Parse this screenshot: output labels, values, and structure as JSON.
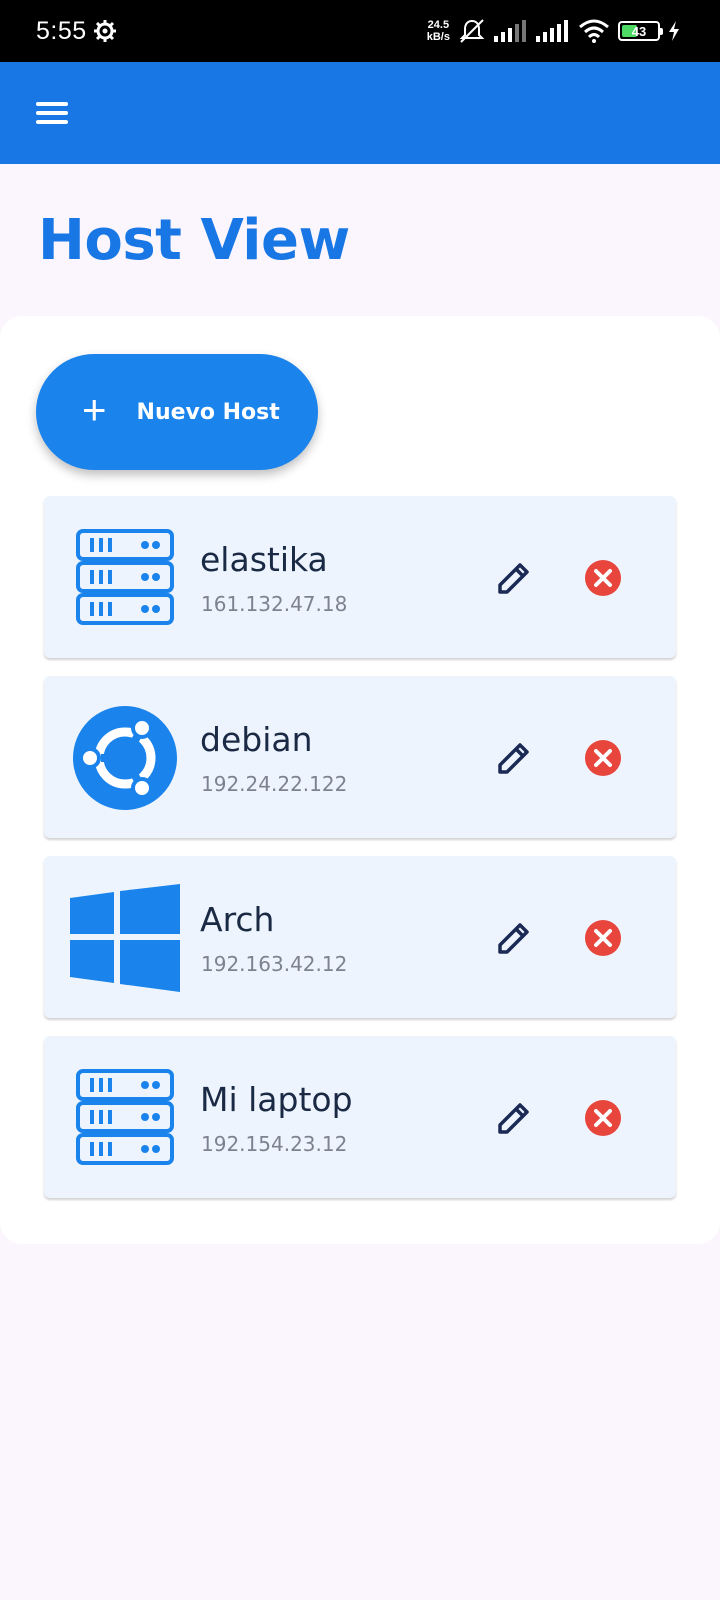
{
  "status_bar": {
    "time": "5:55",
    "net_speed_value": "24.5",
    "net_speed_unit": "kB/s",
    "battery_level": "43",
    "icons": [
      "gear-icon",
      "mute-icon",
      "signal-icon",
      "signal-icon",
      "wifi-icon",
      "battery-icon",
      "charging-icon"
    ]
  },
  "app_bar": {
    "menu_icon": "hamburger-menu-icon",
    "color": "#1877e4"
  },
  "page": {
    "title": "Host View"
  },
  "add_button": {
    "label": "Nuevo Host",
    "icon": "plus-icon"
  },
  "hosts": [
    {
      "name": "elastika",
      "ip": "161.132.47.18",
      "icon": "server-icon"
    },
    {
      "name": "debian",
      "ip": "192.24.22.122",
      "icon": "ubuntu-icon"
    },
    {
      "name": "Arch",
      "ip": "192.163.42.12",
      "icon": "windows-icon"
    },
    {
      "name": "Mi laptop",
      "ip": "192.154.23.12",
      "icon": "server-icon"
    }
  ],
  "colors": {
    "accent": "#1877e4",
    "delete": "#e8453c",
    "edit": "#1b2a55",
    "card": "#eef4fd"
  }
}
